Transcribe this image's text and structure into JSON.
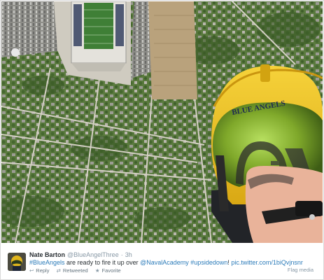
{
  "photo": {
    "helmet_text": "BLUE ANGELS"
  },
  "tweet": {
    "name": "Nate Barton",
    "handle": "@BlueAngelThree",
    "separator": "·",
    "time": "3h",
    "text": {
      "hashtag_blueangels": "#BlueAngels",
      "part1": " are ready to fire it up over ",
      "mention": "@NavalAcademy",
      "space1": " ",
      "hashtag_upsidedown": "#upsidedown",
      "bang": "!",
      "space2": " ",
      "url": "pic.twitter.com/1biQvjnsnr"
    },
    "actions": {
      "reply": "Reply",
      "retweeted": "Retweeted",
      "favorite": "Favorite"
    },
    "icons": {
      "reply": "reply-icon",
      "retweet": "retweet-icon",
      "favorite": "star-icon"
    },
    "flag_media": "Flag media"
  },
  "colors": {
    "link": "#2b7bb9",
    "text": "#292f33",
    "muted": "#8899a6",
    "helmet_yellow": "#f0c020"
  }
}
